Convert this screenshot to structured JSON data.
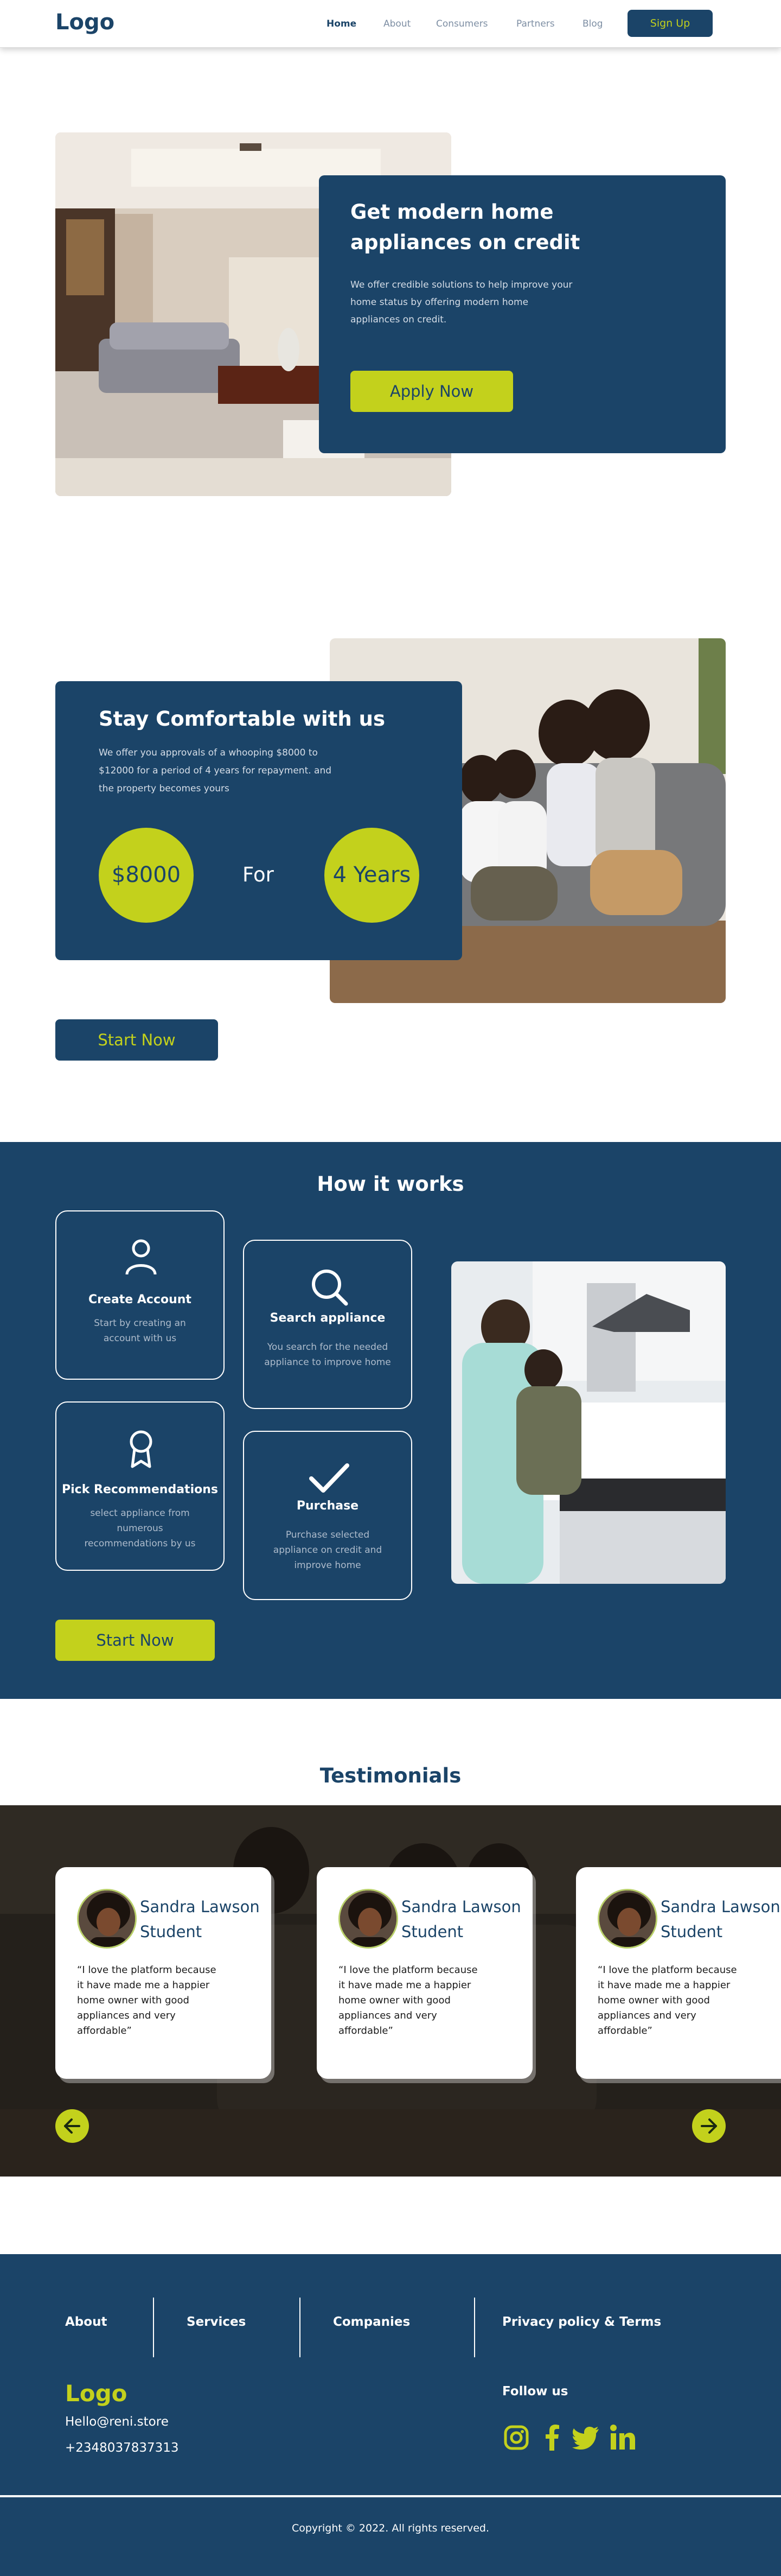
{
  "nav": {
    "logo": "Logo",
    "links": [
      "Home",
      "About",
      "Consumers",
      "Partners",
      "Blog"
    ],
    "signup": "Sign Up"
  },
  "hero": {
    "title": "Get modern home appliances on credit",
    "text": "We offer credible solutions to help improve your home status by offering modern home appliances on credit.",
    "button": "Apply Now"
  },
  "stay": {
    "title": "Stay Comfortable with us",
    "text": "We offer you approvals of a whooping $8000 to $12000 for a period of 4 years for repayment. and the property becomes yours",
    "amount": "$8000",
    "for_label": "For",
    "period": "4 Years",
    "button": "Start Now"
  },
  "how": {
    "title": "How it works",
    "steps": [
      {
        "title": "Create Account",
        "text": "Start by creating an account with us",
        "icon": "user-icon"
      },
      {
        "title": "Search appliance",
        "text": "You search for the needed appliance to improve home",
        "icon": "search-icon"
      },
      {
        "title": "Pick Recommendations",
        "text": "select appliance from numerous recommendations by us",
        "icon": "award-icon"
      },
      {
        "title": "Purchase",
        "text": "Purchase selected appliance on credit and improve home",
        "icon": "check-icon"
      }
    ],
    "button": "Start Now"
  },
  "testimonials": {
    "title": "Testimonials",
    "items": [
      {
        "name": "Sandra Lawson",
        "role": "Student",
        "quote": "“I love the platform because it have made me a happier home owner with good appliances and very affordable”"
      },
      {
        "name": "Sandra Lawson",
        "role": "Student",
        "quote": "“I love the platform because it have made me a happier home owner with good appliances and very affordable”"
      },
      {
        "name": "Sandra Lawson",
        "role": "Student",
        "quote": "“I love the platform because it have made me a happier home owner with good appliances and very affordable”"
      }
    ]
  },
  "footer": {
    "links": [
      "About",
      "Services",
      "Companies",
      "Privacy policy & Terms"
    ],
    "logo": "Logo",
    "email": "Hello@reni.store",
    "phone": "+2348037837313",
    "follow": "Follow us",
    "copyright": "Copyright © 2022.  All rights reserved."
  },
  "colors": {
    "primary": "#1b4468",
    "accent": "#c3d11c",
    "white": "#ffffff"
  }
}
